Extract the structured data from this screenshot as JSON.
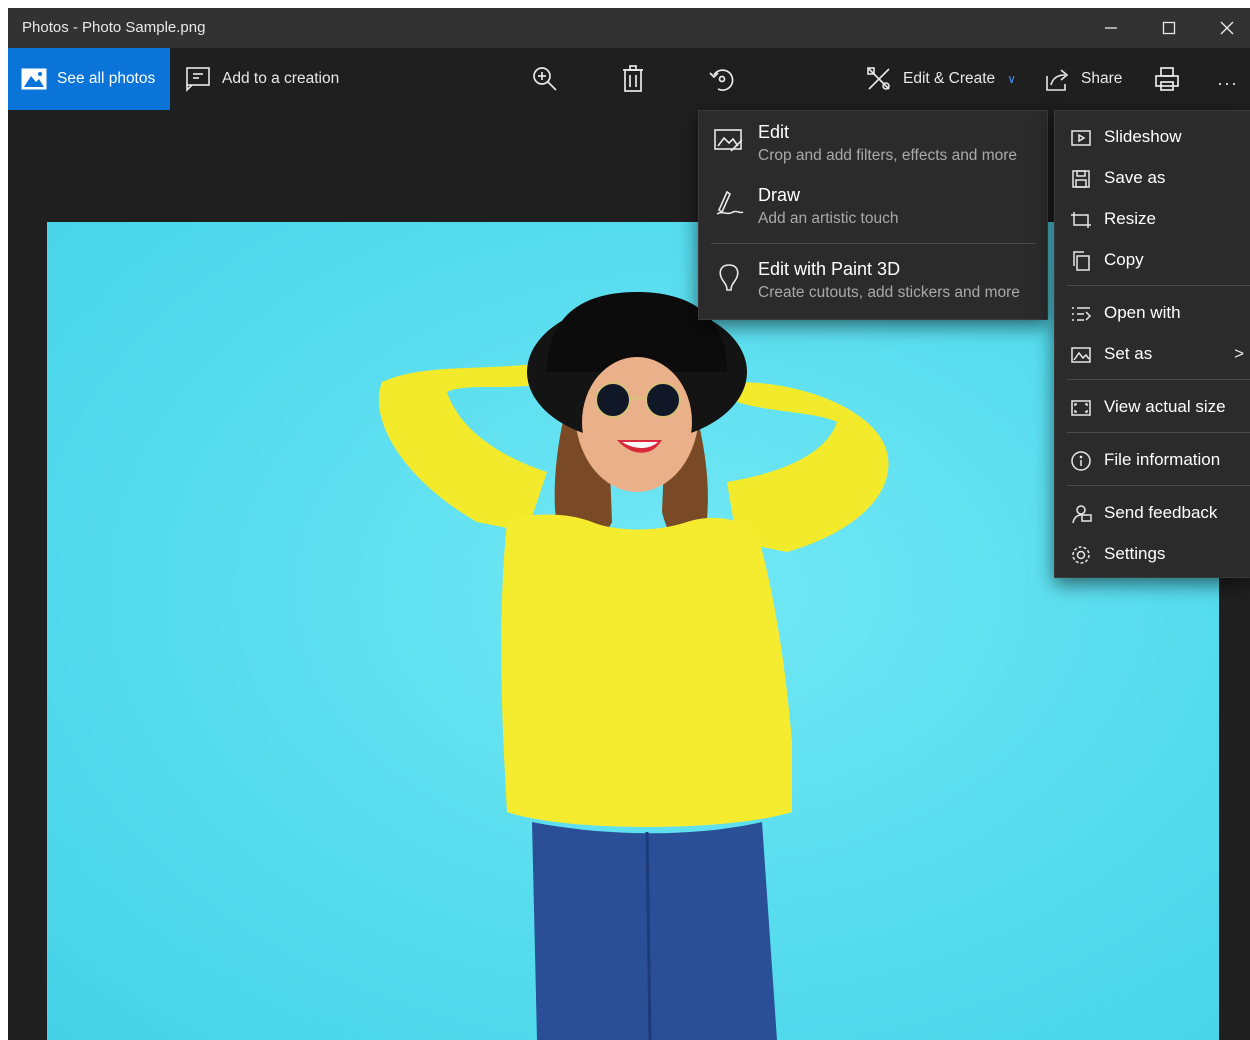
{
  "window": {
    "title": "Photos - Photo Sample.png"
  },
  "titlebar": {
    "minimize_icon": "minimize-icon",
    "maximize_icon": "maximize-icon",
    "close_icon": "close-icon"
  },
  "toolbar": {
    "see_all_photos": "See all photos",
    "add_to_creation": "Add to a creation",
    "edit_create": "Edit & Create",
    "share": "Share",
    "more": "...",
    "accent_color": "#0a74d9"
  },
  "edit_menu": {
    "items": [
      {
        "title": "Edit",
        "subtitle": "Crop and add filters, effects and more",
        "icon": "edit-image-icon"
      },
      {
        "title": "Draw",
        "subtitle": "Add an artistic touch",
        "icon": "draw-pen-icon"
      },
      {
        "title": "Edit with Paint 3D",
        "subtitle": "Create cutouts, add stickers and more",
        "icon": "paint3d-icon"
      }
    ]
  },
  "more_menu": {
    "items": [
      {
        "label": "Slideshow",
        "icon": "slideshow-icon"
      },
      {
        "label": "Save as",
        "icon": "save-icon"
      },
      {
        "label": "Resize",
        "icon": "resize-icon"
      },
      {
        "label": "Copy",
        "icon": "copy-icon"
      },
      {
        "label": "Open with",
        "icon": "open-with-icon"
      },
      {
        "label": "Set as",
        "icon": "set-as-icon",
        "has_submenu": true
      },
      {
        "label": "View actual size",
        "icon": "actual-size-icon"
      },
      {
        "label": "File information",
        "icon": "info-icon"
      },
      {
        "label": "Send feedback",
        "icon": "feedback-icon"
      },
      {
        "label": "Settings",
        "icon": "settings-icon"
      }
    ],
    "submenu_arrow": ">"
  }
}
